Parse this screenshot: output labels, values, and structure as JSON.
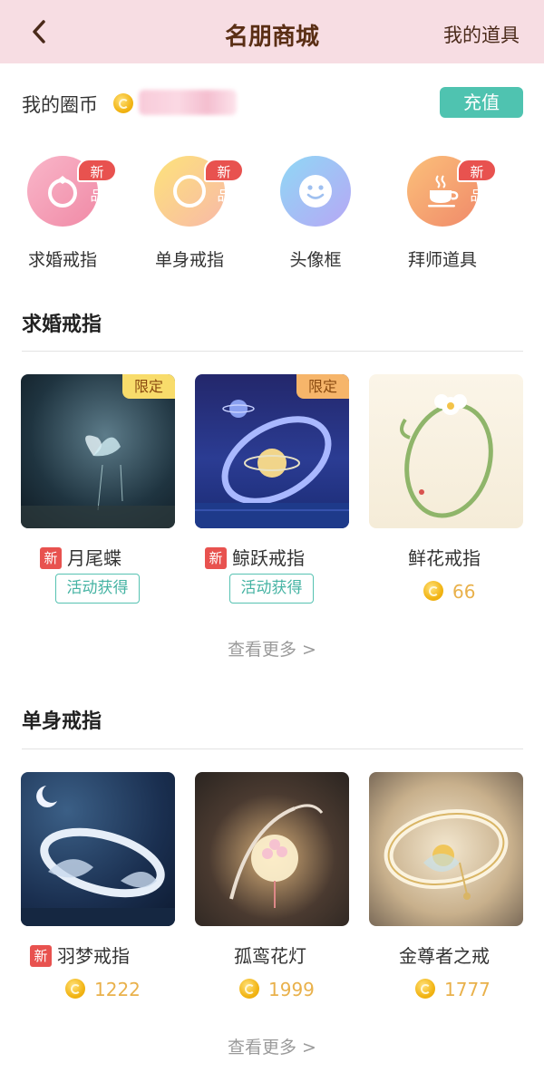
{
  "header": {
    "title": "名朋商城",
    "right_link": "我的道具"
  },
  "coins": {
    "label": "我的圈币",
    "recharge": "充值"
  },
  "categories": [
    {
      "label": "求婚戒指",
      "badge": "新品",
      "icon": "ring-icon"
    },
    {
      "label": "单身戒指",
      "badge": "新品",
      "icon": "ring-icon"
    },
    {
      "label": "头像框",
      "badge": "",
      "icon": "smile-icon"
    },
    {
      "label": "拜师道具",
      "badge": "新品",
      "icon": "tea-cup-icon"
    }
  ],
  "section_proposal": {
    "title": "求婚戒指",
    "items": [
      {
        "name": "月尾蝶",
        "new_badge": "新",
        "tag": "限定",
        "action": "活动获得"
      },
      {
        "name": "鲸跃戒指",
        "new_badge": "新",
        "tag": "限定",
        "action": "活动获得"
      },
      {
        "name": "鲜花戒指",
        "price": "66"
      }
    ],
    "more": "查看更多 >"
  },
  "section_single": {
    "title": "单身戒指",
    "items": [
      {
        "name": "羽梦戒指",
        "new_badge": "新",
        "price": "1222"
      },
      {
        "name": "孤鸾花灯",
        "price": "1999"
      },
      {
        "name": "金尊者之戒",
        "price": "1777"
      }
    ],
    "more": "查看更多 >"
  },
  "colors": {
    "header_bg": "#f7dde3",
    "accent_teal": "#4fc3b0",
    "badge_red": "#e8524f",
    "price_gold": "#e9b14b"
  }
}
